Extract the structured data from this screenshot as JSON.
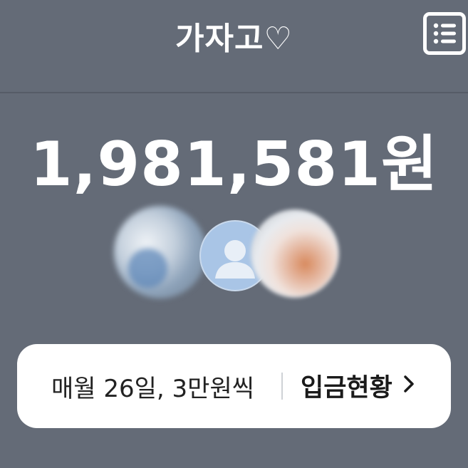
{
  "header": {
    "title": "가자고♡",
    "menu_icon": "list-icon"
  },
  "summary": {
    "total_amount": "1,981,581원"
  },
  "members": [
    {
      "avatar": "blurred-photo"
    },
    {
      "avatar": "default-person-icon"
    },
    {
      "avatar": "blurred-photo"
    }
  ],
  "deposit_card": {
    "schedule_text": "매월 26일, 3만원씩",
    "status_link_label": "입금현황",
    "link_icon": "chevron-right-icon"
  },
  "colors": {
    "background": "#646b77",
    "card": "#ffffff",
    "default_avatar": "#a9c5e6"
  }
}
